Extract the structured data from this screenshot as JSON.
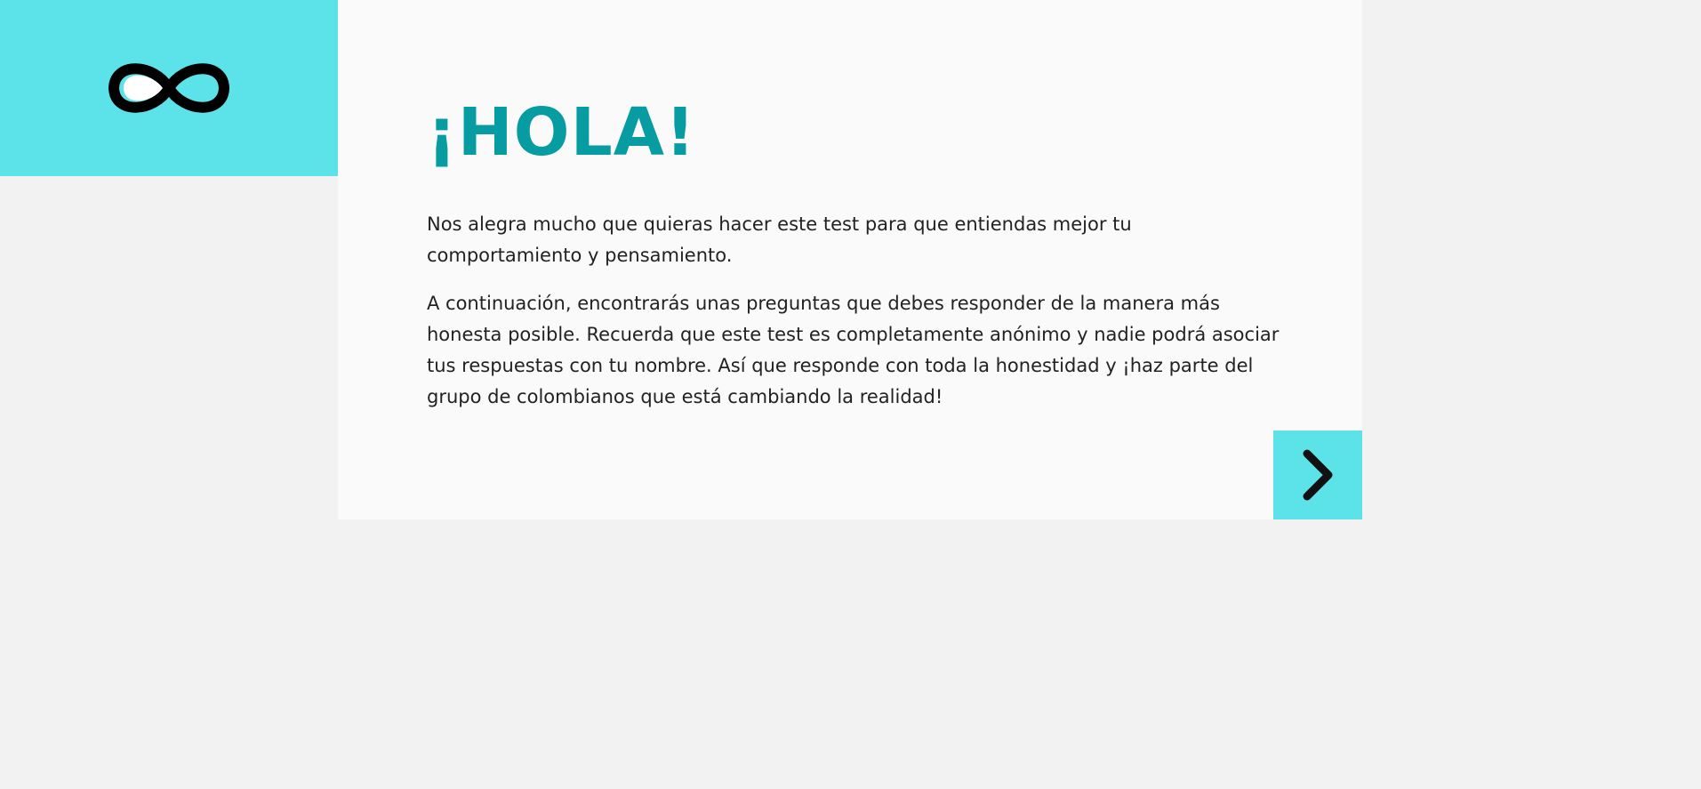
{
  "header": {
    "logo_icon": "infinity-icon"
  },
  "main": {
    "title": "¡HOLA!",
    "paragraphs": [
      "Nos alegra mucho que quieras hacer este test para que entiendas mejor tu comportamiento y pensamiento.",
      "A continuación, encontrarás unas preguntas que debes responder de la manera más honesta posible. Recuerda que este test es completamente anónimo y nadie podrá asociar tus respuestas con tu nombre. Así que responde con toda la honestidad y ¡haz parte del grupo de colombianos que está cambiando la realidad!"
    ],
    "next_icon": "chevron-right-icon"
  },
  "colors": {
    "accent": "#5ce3e9",
    "title": "#069ca1",
    "text": "#222222",
    "card": "#fafafa",
    "background": "#f2f2f2"
  }
}
